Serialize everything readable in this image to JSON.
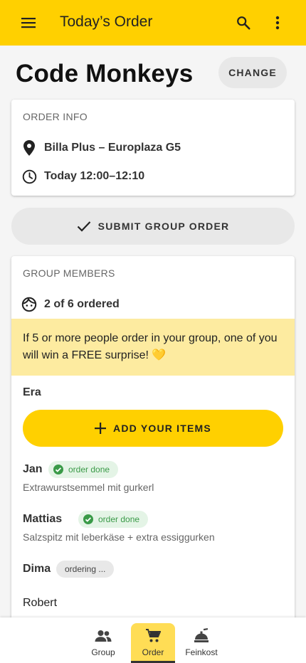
{
  "appbar": {
    "title": "Today’s Order",
    "icons": {
      "menu": "menu-icon",
      "search": "search-icon",
      "more": "more-vert-icon"
    }
  },
  "header": {
    "group_name": "Code Monkeys",
    "change_label": "CHANGE"
  },
  "order_info": {
    "heading": "ORDER INFO",
    "location": "Billa Plus – Europlaza G5",
    "time": "Today 12:00–12:10",
    "icons": {
      "location": "location-pin-icon",
      "time": "clock-icon"
    }
  },
  "submit": {
    "label": "SUBMIT GROUP ORDER",
    "icon": "check-icon"
  },
  "members": {
    "heading": "GROUP MEMBERS",
    "ordered_summary": "2 of 6 ordered",
    "promo": "If 5 or more people order in your group, one of you will win a FREE surprise! 💛",
    "current_user": "Era",
    "add_label": "ADD YOUR ITEMS",
    "list": [
      {
        "name": "Jan",
        "status": "order done",
        "items": "Extrawurstsemmel mit gurkerl"
      },
      {
        "name": "Mattias",
        "status": "order done",
        "items": "Salzspitz mit leberkäse + extra essiggurken"
      },
      {
        "name": "Dima",
        "status": "ordering ...",
        "items": ""
      },
      {
        "name": "Robert",
        "status": "",
        "items": ""
      }
    ]
  },
  "nav": {
    "items": [
      {
        "label": "Group",
        "icon": "group-icon",
        "active": false
      },
      {
        "label": "Order",
        "icon": "cart-icon",
        "active": true
      },
      {
        "label": "Feinkost",
        "icon": "food-icon",
        "active": false
      }
    ]
  },
  "colors": {
    "accent": "#ffd000",
    "promo_bg": "#fdeba0",
    "done_chip_bg": "#e4f4e6",
    "done_chip_text": "#3a9a48"
  }
}
